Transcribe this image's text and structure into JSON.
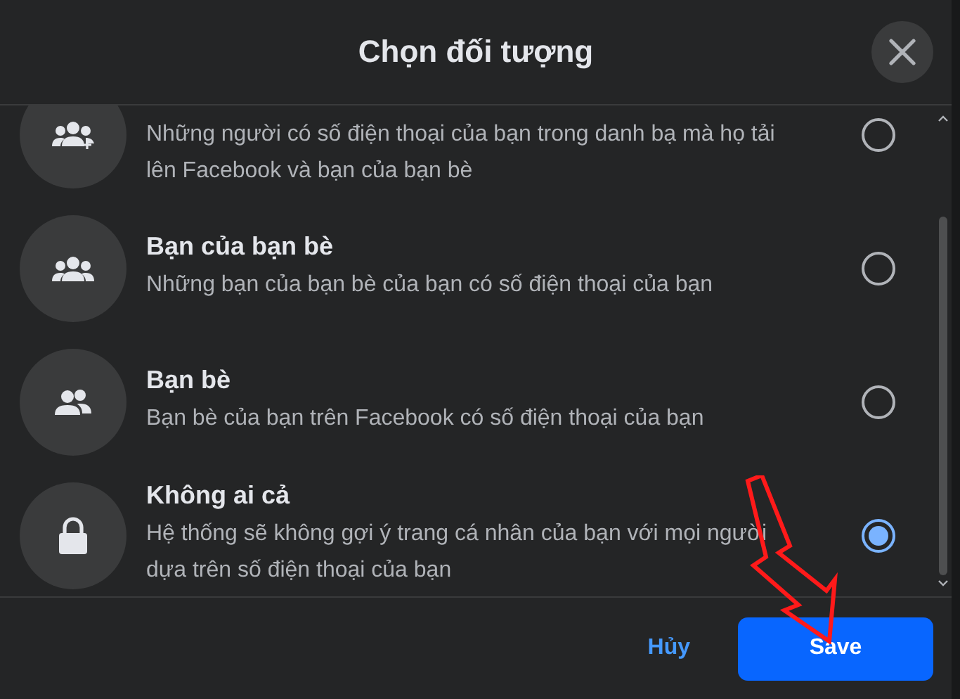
{
  "dialog": {
    "title": "Chọn đối tượng"
  },
  "options": [
    {
      "kind": "group-add",
      "description": "Những người có số điện thoại của bạn trong danh bạ mà họ tải lên Facebook và bạn của bạn bè",
      "selected": false
    },
    {
      "kind": "group",
      "title": "Bạn của bạn bè",
      "description": "Những bạn của bạn bè của bạn có số điện thoại của bạn",
      "selected": false
    },
    {
      "kind": "pair",
      "title": "Bạn bè",
      "description": "Bạn bè của bạn trên Facebook có số điện thoại của bạn",
      "selected": false
    },
    {
      "kind": "lock",
      "title": "Không ai cả",
      "description": "Hệ thống sẽ không gợi ý trang cá nhân của bạn với mọi người dựa trên số điện thoại của bạn",
      "selected": true
    }
  ],
  "buttons": {
    "cancel": "Hủy",
    "save": "Save"
  }
}
